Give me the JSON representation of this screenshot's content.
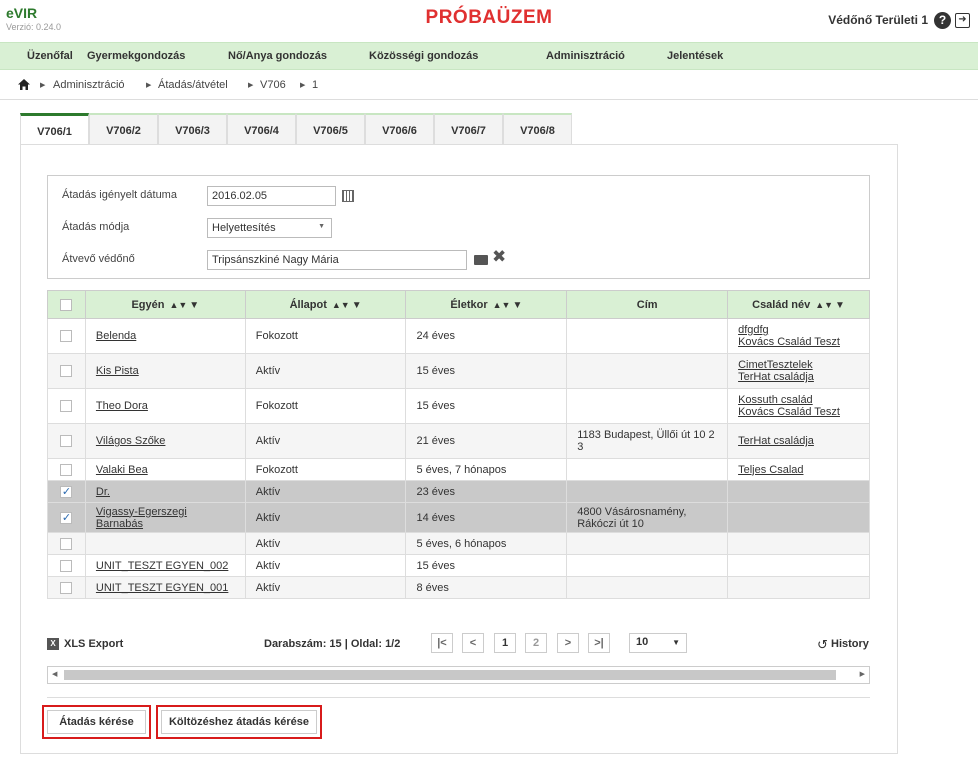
{
  "app": {
    "logo": "eVIR",
    "version": "Verzió: 0.24.0",
    "headline": "PRÓBAÜZEM",
    "user": "Védőnő Területi 1"
  },
  "menu": [
    "Üzenőfal",
    "Gyermekgondozás",
    "Nő/Anya gondozás",
    "Közösségi gondozás",
    "Adminisztráció",
    "Jelentések"
  ],
  "breadcrumb": [
    "Adminisztráció",
    "Átadás/átvétel",
    "V706",
    "1"
  ],
  "tabs": [
    "V706/1",
    "V706/2",
    "V706/3",
    "V706/4",
    "V706/5",
    "V706/6",
    "V706/7",
    "V706/8"
  ],
  "form": {
    "date_label": "Átadás igényelt dátuma",
    "date_value": "2016.02.05",
    "mode_label": "Átadás módja",
    "mode_value": "Helyettesítés",
    "receiver_label": "Átvevő védőnő",
    "receiver_value": "Tripsánszkiné Nagy Mária"
  },
  "table": {
    "headers": [
      "Egyén",
      "Állapot",
      "Életkor",
      "Cím",
      "Család név"
    ],
    "rows": [
      {
        "name": "Belenda",
        "status": "Fokozott",
        "age": "24 éves",
        "address": "",
        "family1": "dfgdfg",
        "family2": "Kovács Család Teszt"
      },
      {
        "name": "Kis Pista",
        "status": "Aktív",
        "age": "15 éves",
        "address": "",
        "family1": "CimetTesztelek",
        "family2": "TerHat családja"
      },
      {
        "name": "Theo Dora",
        "status": "Fokozott",
        "age": "15 éves",
        "address": "",
        "family1": "Kossuth család",
        "family2": "Kovács Család Teszt"
      },
      {
        "name": "Világos Szőke",
        "status": "Aktív",
        "age": "21 éves",
        "address": "1183 Budapest, Üllői út 10 2 3",
        "family1": "TerHat családja",
        "family2": ""
      },
      {
        "name": "Valaki Bea",
        "status": "Fokozott",
        "age": "5 éves, 7 hónapos",
        "address": "",
        "family1": "Teljes Csalad",
        "family2": ""
      },
      {
        "name": "Dr.",
        "status": "Aktív",
        "age": "23 éves",
        "address": "",
        "family1": "",
        "family2": ""
      },
      {
        "name": "Vigassy-Egerszegi Barnabás",
        "status": "Aktív",
        "age": "14 éves",
        "address": "4800 Vásárosnamény, Rákóczi út 10",
        "family1": "",
        "family2": ""
      },
      {
        "name": "",
        "status": "Aktív",
        "age": "5 éves, 6 hónapos",
        "address": "",
        "family1": "",
        "family2": ""
      },
      {
        "name": "UNIT_TESZT EGYEN_002",
        "status": "Aktív",
        "age": "15 éves",
        "address": "",
        "family1": "",
        "family2": ""
      },
      {
        "name": "UNIT_TESZT EGYEN_001",
        "status": "Aktív",
        "age": "8 éves",
        "address": "",
        "family1": "",
        "family2": ""
      }
    ],
    "selected_rows": [
      5,
      6
    ]
  },
  "footer": {
    "xls_label": "XLS Export",
    "count_text": "Darabszám: 15 | Oldal: 1/2",
    "pages": [
      "1",
      "2"
    ],
    "page_size": "10",
    "history_label": "History"
  },
  "buttons": {
    "request": "Átadás kérése",
    "move_request": "Költözéshez átadás kérése"
  },
  "colors": {
    "accent_green": "#2d7a2d",
    "menu_bg": "#d9f0d4",
    "headline_red": "#e03030",
    "highlight_red": "#d81b1b"
  }
}
